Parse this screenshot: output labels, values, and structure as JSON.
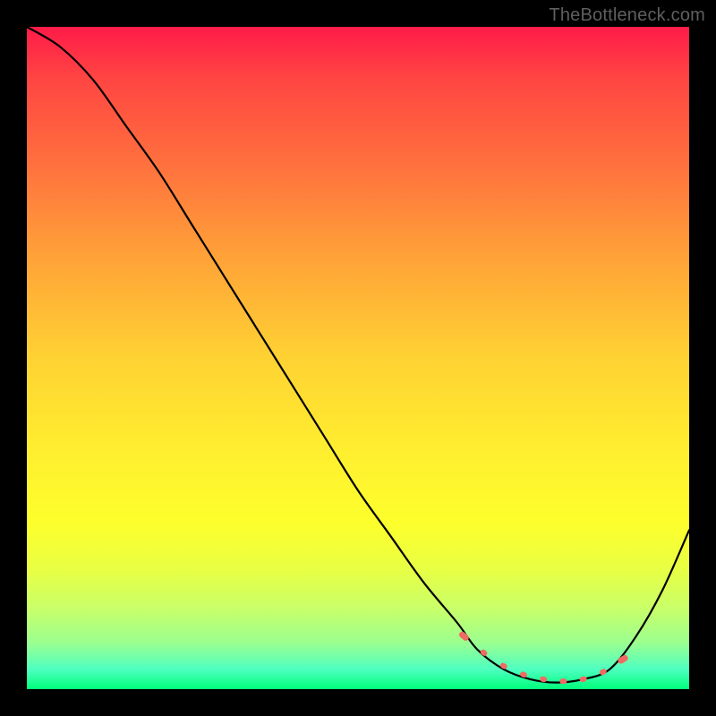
{
  "watermark": "TheBottleneck.com",
  "chart_data": {
    "type": "line",
    "title": "",
    "xlabel": "",
    "ylabel": "",
    "xlim": [
      0,
      100
    ],
    "ylim": [
      0,
      100
    ],
    "series": [
      {
        "name": "bottleneck-curve",
        "x": [
          0,
          5,
          10,
          15,
          20,
          25,
          30,
          35,
          40,
          45,
          50,
          55,
          60,
          65,
          68,
          72,
          76,
          80,
          84,
          88,
          92,
          96,
          100
        ],
        "y": [
          100,
          97,
          92,
          85,
          78,
          70,
          62,
          54,
          46,
          38,
          30,
          23,
          16,
          10,
          6,
          3,
          1.5,
          1,
          1.5,
          3,
          8,
          15,
          24
        ]
      }
    ],
    "markers": {
      "name": "sweet-spot",
      "x": [
        66,
        69,
        72,
        75,
        78,
        81,
        84,
        87,
        90
      ],
      "y": [
        8,
        5.5,
        3.5,
        2.2,
        1.5,
        1.2,
        1.5,
        2.6,
        4.5
      ]
    },
    "gradient_stops": [
      {
        "pos": 0,
        "color": "#ff1b49"
      },
      {
        "pos": 50,
        "color": "#ffd233"
      },
      {
        "pos": 100,
        "color": "#00ff7b"
      }
    ]
  }
}
